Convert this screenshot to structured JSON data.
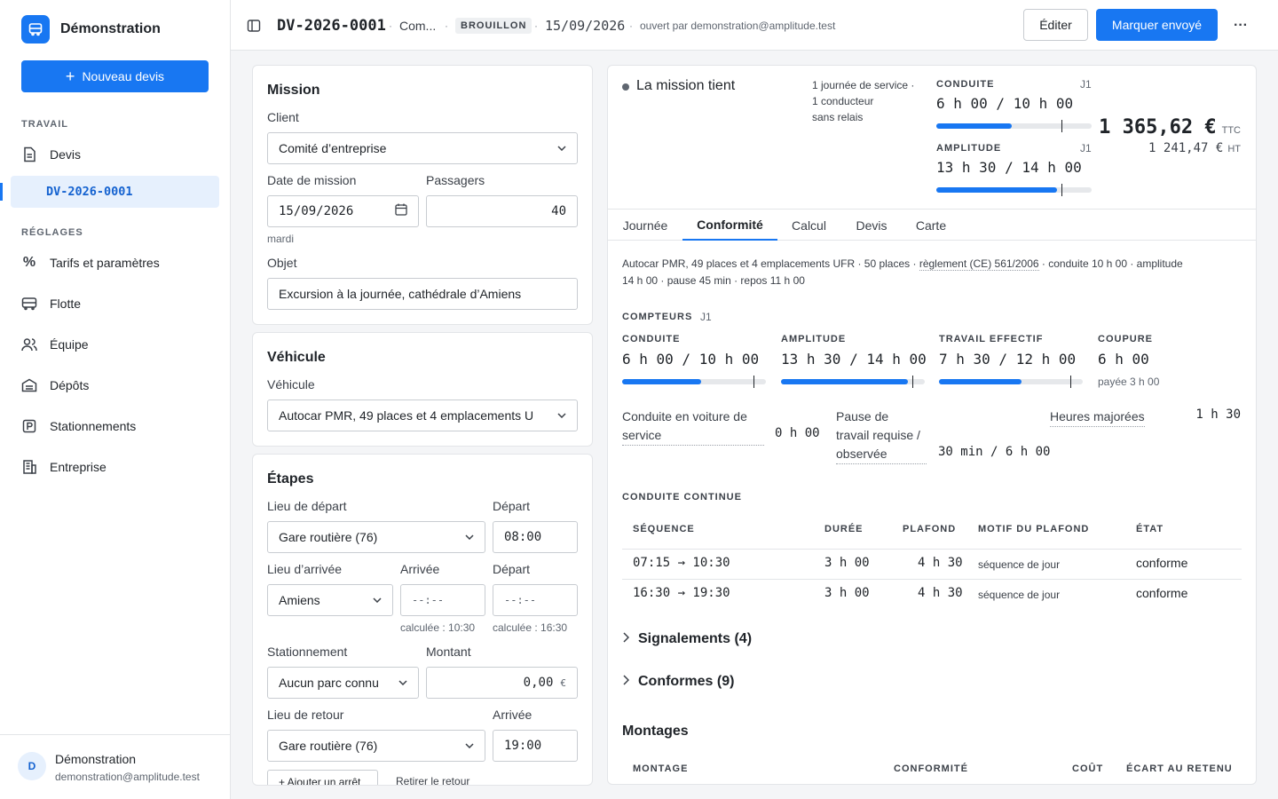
{
  "sidebar": {
    "brand": "Démonstration",
    "new_button": "Nouveau devis",
    "section_work": "TRAVAIL",
    "nav_devis": "Devis",
    "nav_current": "DV-2026-0001",
    "section_settings": "RÉGLAGES",
    "nav_tarifs": "Tarifs et paramètres",
    "nav_flotte": "Flotte",
    "nav_equipe": "Équipe",
    "nav_depots": "Dépôts",
    "nav_stationnements": "Stationnements",
    "nav_entreprise": "Entreprise",
    "user_initial": "D",
    "user_name": "Démonstration",
    "user_email": "demonstration@amplitude.test"
  },
  "header": {
    "quote_id": "DV-2026-0001",
    "client_short": "Com...",
    "status": "BROUILLON",
    "date": "15/09/2026",
    "opened_by": "ouvert par demonstration@amplitude.test",
    "edit_label": "Éditer",
    "mark_sent_label": "Marquer envoyé",
    "more_label": "···"
  },
  "mission": {
    "title": "Mission",
    "client_label": "Client",
    "client_value": "Comité d’entreprise",
    "date_label": "Date de mission",
    "date_value": "15/09/2026",
    "date_weekday": "mardi",
    "passengers_label": "Passagers",
    "passengers_value": "40",
    "object_label": "Objet",
    "object_value": "Excursion à la journée, cathédrale d’Amiens"
  },
  "vehicle": {
    "title": "Véhicule",
    "label": "Véhicule",
    "value": "Autocar PMR, 49 places et 4 emplacements U"
  },
  "steps": {
    "title": "Étapes",
    "departure_place_label": "Lieu de départ",
    "departure_place_value": "Gare routière (76)",
    "departure_time_label": "Départ",
    "departure_time_value": "08:00",
    "arrival_place_label": "Lieu d’arrivée",
    "arrival_place_value": "Amiens",
    "arrival_time_label": "Arrivée",
    "arrival_time_placeholder": "--:--",
    "arrival_calc": "calculée : 10:30",
    "depart2_label": "Départ",
    "depart2_placeholder": "--:--",
    "depart2_calc": "calculée : 16:30",
    "parking_label": "Stationnement",
    "parking_value": "Aucun parc connu",
    "amount_label": "Montant",
    "amount_value": "0,00",
    "amount_currency": "€",
    "return_place_label": "Lieu de retour",
    "return_place_value": "Gare routière (76)",
    "return_time_label": "Arrivée",
    "return_time_value": "19:00",
    "add_stop": "+ Ajouter un arrêt",
    "remove_return": "Retirer le retour"
  },
  "summary": {
    "status_text": "La mission tient",
    "status_color": "#5f6670",
    "detail_1": "1 journée de service ·",
    "detail_2": "1 conducteur",
    "detail_3": "sans relais",
    "conduite_label": "CONDUITE",
    "conduite_day": "J1",
    "conduite_value": "6 h 00 / 10 h 00",
    "conduite_fraction": 0.6,
    "amplitude_label": "AMPLITUDE",
    "amplitude_day": "J1",
    "amplitude_value": "13 h 30 / 14 h 00",
    "amplitude_fraction": 0.964,
    "price_ttc": "1 365,62 €",
    "price_ttc_unit": "TTC",
    "price_ht": "1 241,47 €",
    "price_ht_unit": "HT",
    "accent": "#1877f2"
  },
  "tabs": [
    "Journée",
    "Conformité",
    "Calcul",
    "Devis",
    "Carte"
  ],
  "conformity": {
    "intro_1": "Autocar PMR, 49 places et 4 emplacements UFR · 50 places ·",
    "intro_link": "règlement (CE) 561/2006",
    "intro_2": "· conduite 10 h 00 · amplitude",
    "intro_3": "14 h 00 · pause 45 min · repos 11 h 00",
    "counters_label": "COMPTEURS",
    "counters_day": "J1",
    "c_conduite_label": "CONDUITE",
    "c_conduite_value": "6 h 00 / 10 h 00",
    "c_conduite_fraction": 0.6,
    "c_amplitude_label": "AMPLITUDE",
    "c_amplitude_value": "13 h 30 / 14 h 00",
    "c_amplitude_fraction": 0.964,
    "c_travail_label": "TRAVAIL EFFECTIF",
    "c_travail_value": "7 h 30 / 12 h 00",
    "c_travail_fraction": 0.625,
    "c_coupure_label": "COUPURE",
    "c_coupure_value": "6 h 00",
    "c_coupure_paid": "payée 3 h 00",
    "service_drive_label_1": "Conduite en voiture de",
    "service_drive_label_2": "service",
    "service_drive_value": "0 h 00",
    "pause_label_1": "Pause de",
    "pause_label_2": "travail requise /",
    "pause_label_3": "observée",
    "pause_value": "30 min / 6 h 00",
    "overtime_label": "Heures majorées",
    "overtime_value": "1 h 30",
    "continuous_label": "CONDUITE CONTINUE",
    "table_headers": [
      "SÉQUENCE",
      "DURÉE",
      "PLAFOND",
      "MOTIF DU PLAFOND",
      "ÉTAT"
    ],
    "rows": [
      {
        "seq": "07:15 → 10:30",
        "duration": "3 h 00",
        "cap": "4 h 30",
        "reason": "séquence de jour",
        "state": "conforme"
      },
      {
        "seq": "16:30 → 19:30",
        "duration": "3 h 00",
        "cap": "4 h 30",
        "reason": "séquence de jour",
        "state": "conforme"
      }
    ],
    "signals": "Signalements (4)",
    "compliant": "Conformes (9)",
    "montages_title": "Montages",
    "montages_headers": [
      "MONTAGE",
      "CONFORMITÉ",
      "COÛT",
      "ÉCART AU RETENU"
    ]
  }
}
